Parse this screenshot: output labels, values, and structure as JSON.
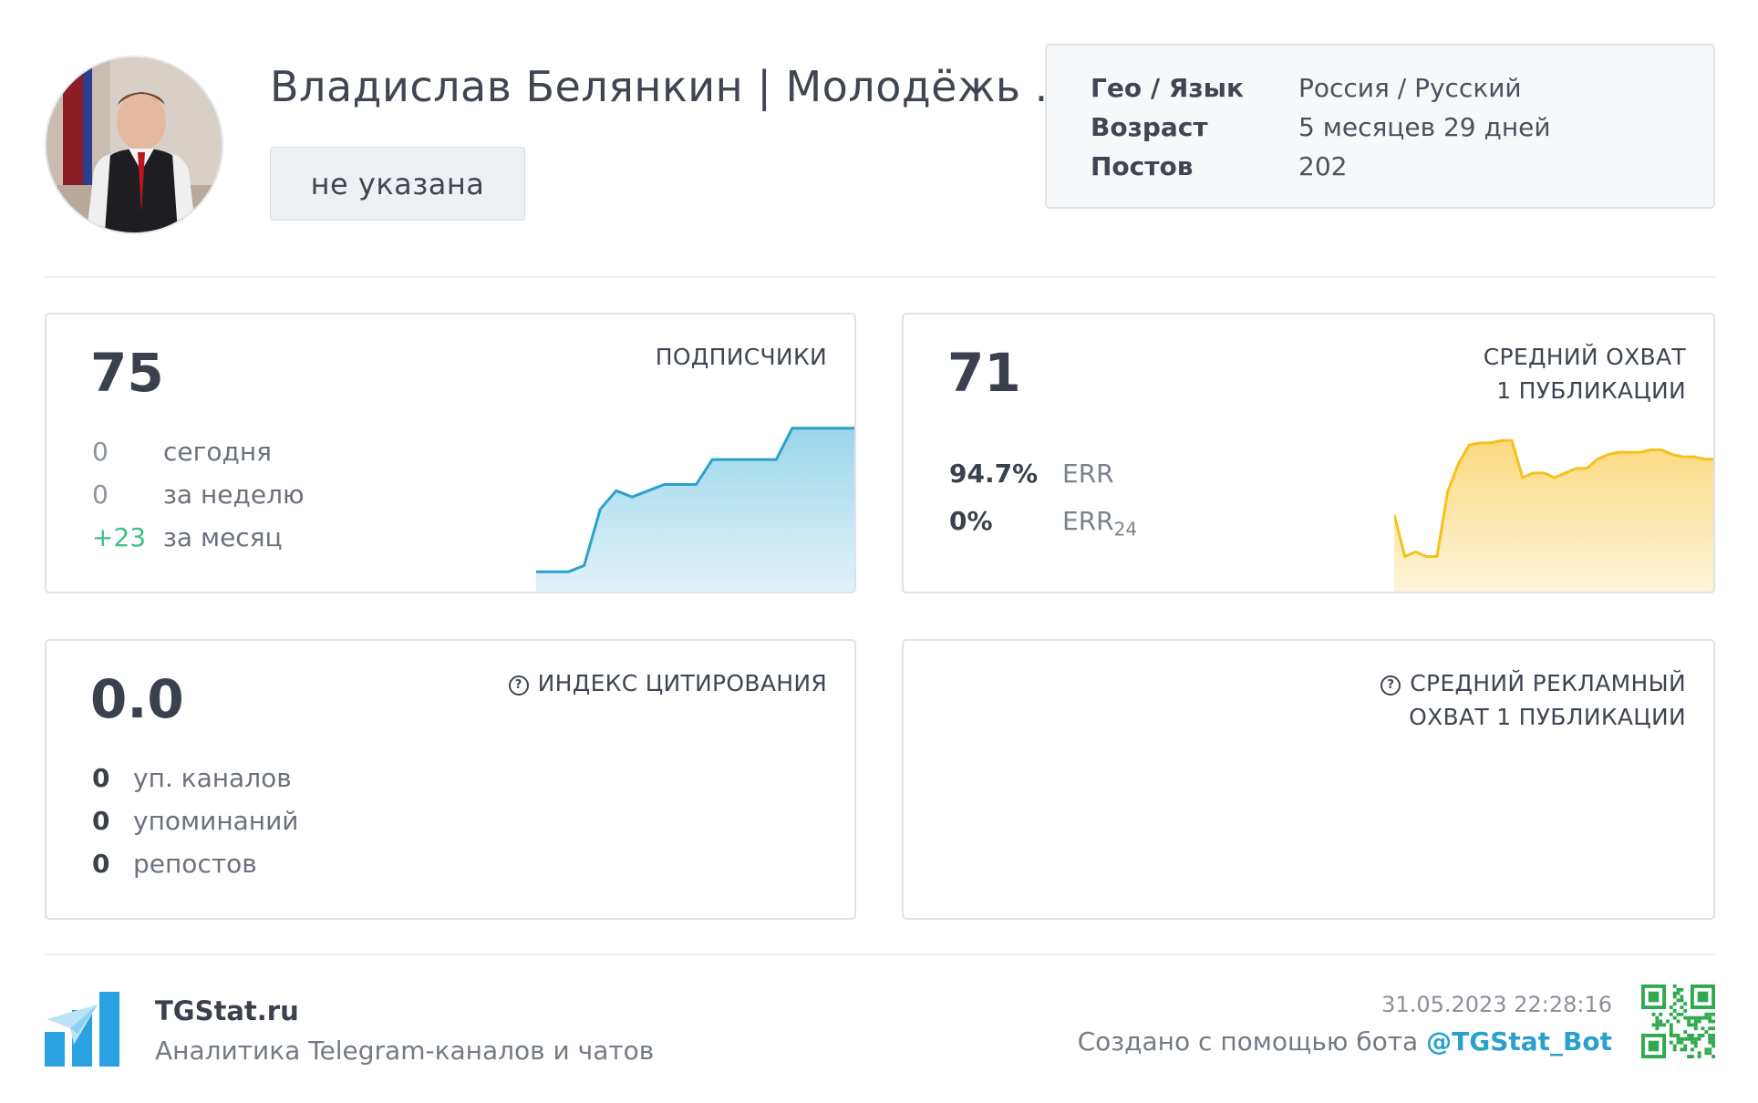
{
  "header": {
    "channel_name": "Владислав Белянкин | Молодёжь ...",
    "category_button": "не указана",
    "info": [
      {
        "key": "Гео / Язык",
        "value": "Россия / Русский"
      },
      {
        "key": "Возраст",
        "value": "5 месяцев 29 дней"
      },
      {
        "key": "Постов",
        "value": "202"
      }
    ]
  },
  "subscribers": {
    "title": "ПОДПИСЧИКИ",
    "value": "75",
    "rows": [
      {
        "num": "0",
        "label": "сегодня"
      },
      {
        "num": "0",
        "label": "за неделю"
      },
      {
        "num": "+23",
        "label": "за месяц"
      }
    ],
    "color": "#2aa1cc"
  },
  "reach": {
    "title_line1": "СРЕДНИЙ ОХВАТ",
    "title_line2": "1 ПУБЛИКАЦИИ",
    "value": "71",
    "err": {
      "num": "94.7%",
      "label": "ERR"
    },
    "err24": {
      "num": "0%",
      "label": "ERR",
      "sub": "24"
    },
    "color": "#f5c21b"
  },
  "citation": {
    "title": "ИНДЕКС ЦИТИРОВАНИЯ",
    "value": "0.0",
    "rows": [
      {
        "num": "0",
        "label": "уп. каналов"
      },
      {
        "num": "0",
        "label": "упоминаний"
      },
      {
        "num": "0",
        "label": "репостов"
      }
    ]
  },
  "ad_reach": {
    "title_line1": "СРЕДНИЙ РЕКЛАМНЫЙ",
    "title_line2": "ОХВАТ 1 ПУБЛИКАЦИИ"
  },
  "footer": {
    "brand": "TGStat.ru",
    "tagline": "Аналитика Telegram-каналов и чатов",
    "timestamp": "31.05.2023 22:28:16",
    "created_text": "Создано с помощью бота",
    "bot": "@TGStat_Bot"
  },
  "chart_data": [
    {
      "type": "area",
      "series": [
        {
          "values": [
            52,
            52,
            52,
            53,
            62,
            65,
            64,
            65,
            66,
            66,
            66,
            70,
            70,
            70,
            70,
            70,
            75,
            75,
            75,
            75,
            75
          ]
        }
      ],
      "ylim": [
        50,
        76
      ]
    },
    {
      "type": "area",
      "series": [
        {
          "values": [
            40,
            22,
            24,
            22,
            22,
            50,
            62,
            70,
            71,
            71,
            72,
            72,
            56,
            58,
            58,
            56,
            58,
            60,
            60,
            64,
            66,
            67,
            67,
            67,
            68,
            68,
            66,
            65,
            65,
            64,
            64
          ]
        }
      ],
      "ylim": [
        10,
        80
      ]
    }
  ]
}
